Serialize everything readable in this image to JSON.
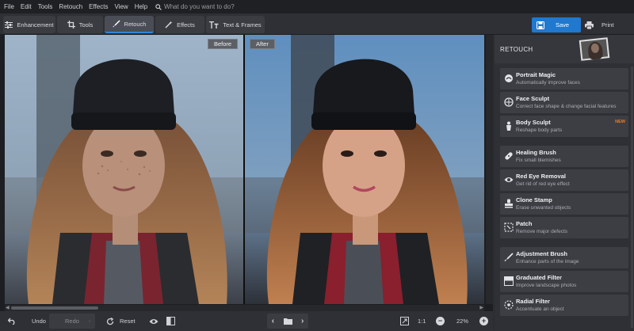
{
  "menu": {
    "items": [
      "File",
      "Edit",
      "Tools",
      "Retouch",
      "Effects",
      "View",
      "Help"
    ],
    "search_placeholder": "What do you want to do?"
  },
  "toolbar": {
    "tabs": [
      {
        "label": "Enhancement",
        "icon": "sliders-icon"
      },
      {
        "label": "Tools",
        "icon": "crop-icon"
      },
      {
        "label": "Retouch",
        "icon": "brush-icon",
        "active": true
      },
      {
        "label": "Effects",
        "icon": "magic-wand-icon"
      },
      {
        "label": "Text & Frames",
        "icon": "text-icon"
      }
    ],
    "save_label": "Save",
    "print_label": "Print",
    "accent": "#2078cf"
  },
  "canvas": {
    "before_label": "Before",
    "after_label": "After"
  },
  "bottom": {
    "undo_label": "Undo",
    "redo_label": "Redo",
    "reset_label": "Reset",
    "ratio_label": "1:1",
    "zoom": "22%"
  },
  "panel": {
    "title": "RETOUCH",
    "items": [
      {
        "title": "Portrait Magic",
        "desc": "Automatically improve faces",
        "icon": "magic-face-icon"
      },
      {
        "title": "Face Sculpt",
        "desc": "Correct face shape & change facial features",
        "icon": "face-sculpt-icon"
      },
      {
        "title": "Body Sculpt",
        "desc": "Reshape body parts",
        "icon": "body-sculpt-icon",
        "badge": "NEW"
      },
      {
        "title": "Healing Brush",
        "desc": "Fix small blemishes",
        "icon": "bandage-icon"
      },
      {
        "title": "Red Eye Removal",
        "desc": "Get rid of red eye effect",
        "icon": "eye-icon"
      },
      {
        "title": "Clone Stamp",
        "desc": "Erase unwanted objects",
        "icon": "stamp-icon"
      },
      {
        "title": "Patch",
        "desc": "Remove major defects",
        "icon": "patch-icon"
      },
      {
        "title": "Adjustment Brush",
        "desc": "Enhance parts of the image",
        "icon": "brush-icon"
      },
      {
        "title": "Graduated Filter",
        "desc": "Improve landscape photos",
        "icon": "graduated-filter-icon"
      },
      {
        "title": "Radial Filter",
        "desc": "Accentuate an object",
        "icon": "radial-filter-icon"
      }
    ],
    "badge_color": "#f07b23"
  }
}
